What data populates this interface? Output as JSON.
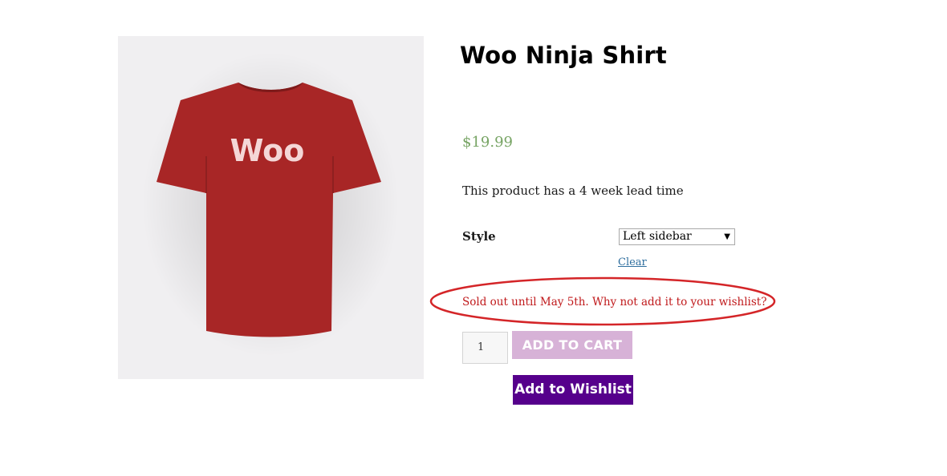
{
  "product": {
    "title": "Woo Ninja Shirt",
    "price": "$19.99",
    "lead_time_note": "This product has a 4 week lead time",
    "image_label": "Woo",
    "shirt_color": "#a82626"
  },
  "variation": {
    "label": "Style",
    "selected": "Left sidebar",
    "clear_link": "Clear"
  },
  "stock": {
    "message": "Sold out until May 5th. Why not add it to your wishlist?",
    "highlight_color": "#d42528"
  },
  "cart": {
    "quantity": "1",
    "add_to_cart_label": "ADD TO CART",
    "add_to_wishlist_label": "Add to Wishlist"
  },
  "colors": {
    "price": "#77a464",
    "disabled_button": "#d7b2d7",
    "wishlist_button": "#56008c"
  }
}
